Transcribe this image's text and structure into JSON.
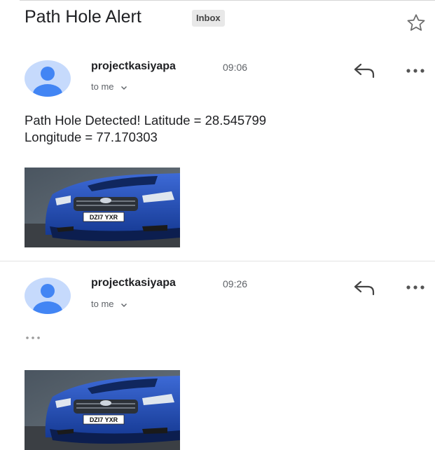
{
  "subject": "Path Hole Alert",
  "label": "Inbox",
  "messages": [
    {
      "sender": "projectkasiyapa",
      "time": "09:06",
      "recipient": "to me",
      "body_line1": "Path Hole Detected!  Latitude = 28.545799",
      "body_line2": "Longitude = 77.170303",
      "plate_text": "DZI7 YXR"
    },
    {
      "sender": "projectkasiyapa",
      "time": "09:26",
      "recipient": "to me",
      "plate_text": "DZI7 YXR"
    }
  ],
  "colors": {
    "avatar_bg": "#c6dafc",
    "avatar_fg": "#4285f4",
    "car_blue": "#1f45a8"
  }
}
